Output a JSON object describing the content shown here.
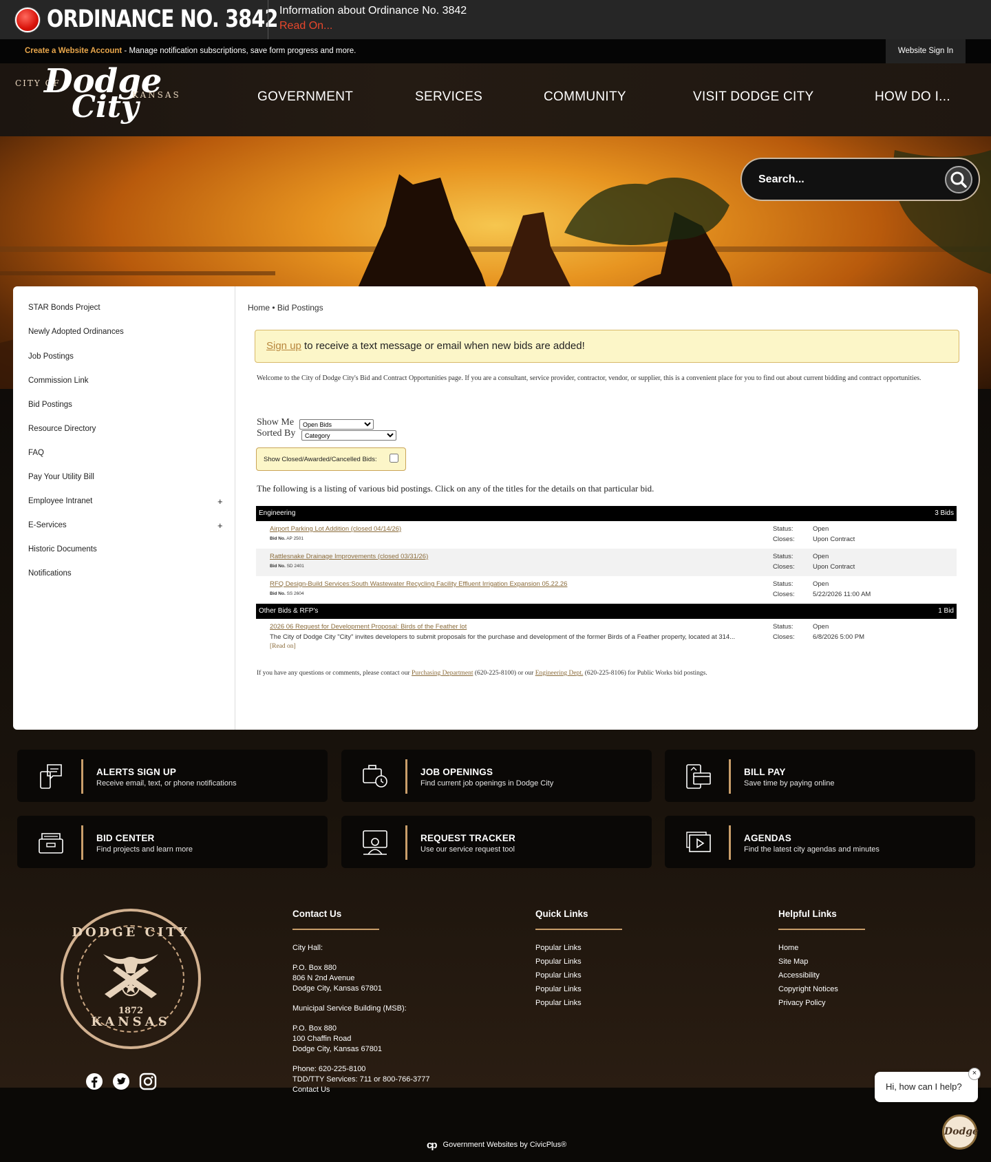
{
  "alert": {
    "headline": "ORDINANCE NO. 3842",
    "info": "Information about Ordinance No. 3842",
    "read_on": "Read On..."
  },
  "utility_bar": {
    "create_account": "Create a Website Account",
    "message": " - Manage notification subscriptions, save form progress and more.",
    "sign_in": "Website Sign In"
  },
  "logo": {
    "city_of": "CITY OF",
    "dodge": "Dodge",
    "city": "City",
    "kansas": "KANSAS"
  },
  "nav": [
    "GOVERNMENT",
    "SERVICES",
    "COMMUNITY",
    "VISIT DODGE CITY",
    "HOW DO I..."
  ],
  "search": {
    "placeholder": "Search..."
  },
  "sidebar": {
    "items": [
      {
        "label": "STAR Bonds Project"
      },
      {
        "label": "Newly Adopted Ordinances"
      },
      {
        "label": "Job Postings"
      },
      {
        "label": "Commission Link"
      },
      {
        "label": "Bid Postings"
      },
      {
        "label": "Resource Directory"
      },
      {
        "label": "FAQ"
      },
      {
        "label": "Pay Your Utility Bill"
      },
      {
        "label": "Employee Intranet",
        "expand": "+"
      },
      {
        "label": "E-Services",
        "expand": "+"
      },
      {
        "label": "Historic Documents"
      },
      {
        "label": "Notifications"
      }
    ]
  },
  "breadcrumb": {
    "home": "Home",
    "sep": " • ",
    "current": "Bid Postings"
  },
  "signup_banner": {
    "link": "Sign up",
    "text": " to receive a text message or email when new bids are added!"
  },
  "welcome": "Welcome to the City of Dodge City's Bid and Contract Opportunities page. If you are a consultant, service provider, contractor, vendor, or supplier, this is a convenient place for you to find out about current bidding and contract opportunities.",
  "filters": {
    "show_me_label": "Show Me",
    "show_me_value": "Open Bids",
    "sorted_by_label": "Sorted By",
    "sorted_by_value": "Category",
    "closed_label": "Show Closed/Awarded/Cancelled Bids:"
  },
  "listing_intro": "The following is a listing of various bid postings. Click on any of the titles for the details on that particular bid.",
  "categories": [
    {
      "name": "Engineering",
      "count": "3 Bids",
      "bids": [
        {
          "title": "Airport Parking Lot Addition (closed 04/14/26)",
          "bid_no_label": "Bid No.",
          "bid_no": "AP 2501",
          "status_label": "Status:",
          "status": "Open",
          "closes_label": "Closes:",
          "closes": "Upon Contract"
        },
        {
          "title": "Rattlesnake Drainage Improvements (closed 03/31/26)",
          "bid_no_label": "Bid No.",
          "bid_no": "SD 2401",
          "status_label": "Status:",
          "status": "Open",
          "closes_label": "Closes:",
          "closes": "Upon Contract"
        },
        {
          "title": "RFQ Design-Build Services:South Wastewater Recycling Facility Effluent Irrigation Expansion 05.22.26",
          "bid_no_label": "Bid No.",
          "bid_no": "SS 2604",
          "status_label": "Status:",
          "status": "Open",
          "closes_label": "Closes:",
          "closes": "5/22/2026 11:00 AM"
        }
      ]
    },
    {
      "name": "Other Bids & RFP's",
      "count": "1 Bid",
      "bids": [
        {
          "title": "2026 06 Request for Development Proposal: Birds of the Feather lot",
          "description": "The City of Dodge City \"City\" invites developers to submit proposals for the purchase and development of the former Birds of a Feather property, located at 314...",
          "read_on": "[Read on]",
          "status_label": "Status:",
          "status": "Open",
          "closes_label": "Closes:",
          "closes": "6/8/2026 5:00 PM"
        }
      ]
    }
  ],
  "footnote": {
    "pre": "If you have any questions or comments, please contact our ",
    "link1": "Purchasing Department",
    "mid": " (620-225-8100) or our ",
    "link2": "Engineering Dept.",
    "post": " (620-225-8106) for Public Works bid postings."
  },
  "tiles": [
    {
      "title": "ALERTS SIGN UP",
      "subtitle": "Receive email, text, or phone notifications",
      "icon": "phone-chat-icon"
    },
    {
      "title": "JOB OPENINGS",
      "subtitle": "Find current job openings in Dodge City",
      "icon": "briefcase-clock-icon"
    },
    {
      "title": "BILL PAY",
      "subtitle": "Save time by paying online",
      "icon": "devices-pay-icon"
    },
    {
      "title": "BID CENTER",
      "subtitle": "Find projects and learn more",
      "icon": "file-drawer-icon"
    },
    {
      "title": "REQUEST TRACKER",
      "subtitle": "Use our service request tool",
      "icon": "person-screen-icon"
    },
    {
      "title": "AGENDAS",
      "subtitle": "Find the latest city agendas and minutes",
      "icon": "video-stack-icon"
    }
  ],
  "seal": {
    "top": "DODGE CITY",
    "bottom": "KANSAS",
    "year": "1872"
  },
  "footer": {
    "contact": {
      "heading": "Contact Us",
      "lines": [
        "City Hall:",
        "P.O. Box 880",
        "806 N 2nd Avenue",
        "Dodge City, Kansas 67801",
        "Municipal Service Building (MSB):",
        "P.O. Box 880",
        "100 Chaffin Road",
        "Dodge City, Kansas 67801",
        "Phone: 620-225-8100",
        "TDD/TTY Services: 711 or 800-766-3777",
        "Contact Us"
      ]
    },
    "quick": {
      "heading": "Quick Links",
      "links": [
        "Popular Links",
        "Popular Links",
        "Popular Links",
        "Popular Links",
        "Popular Links"
      ]
    },
    "helpful": {
      "heading": "Helpful Links",
      "links": [
        "Home",
        "Site Map",
        "Accessibility",
        "Copyright Notices",
        "Privacy Policy"
      ]
    }
  },
  "powered_by": {
    "mark": "cp",
    "text": "Government Websites by CivicPlus®"
  },
  "chat": {
    "greeting": "Hi, how can I help?",
    "close": "×",
    "avatar": "Dodge"
  },
  "colors": {
    "accent": "#c99e6a",
    "alert_red": "#e8472c",
    "link_brown": "#8a6b3a",
    "notice_yellow": "#fcf6c8"
  }
}
